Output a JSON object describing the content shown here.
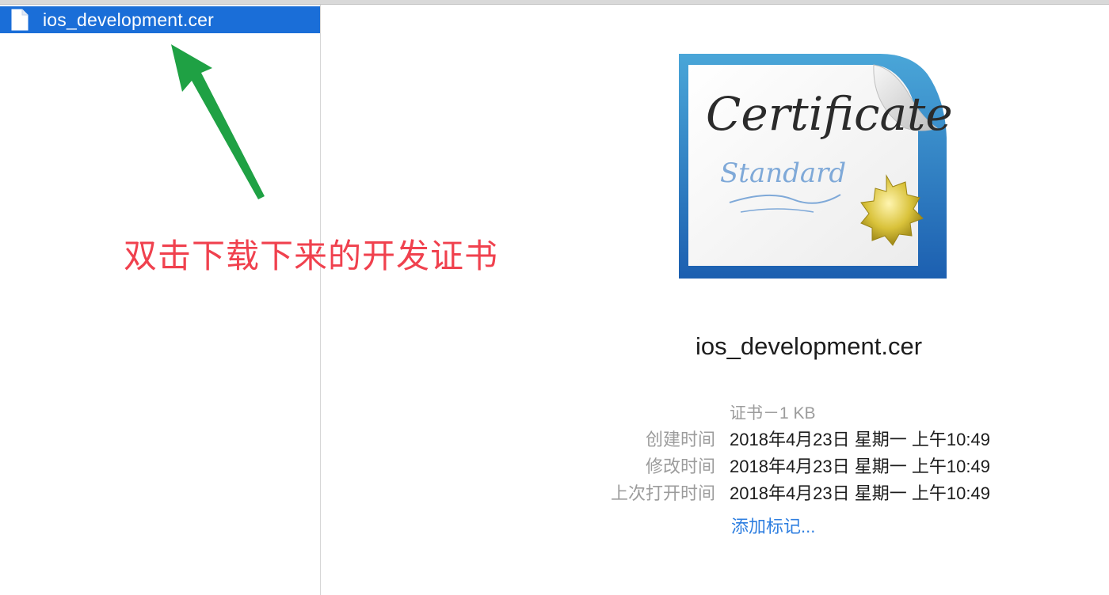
{
  "sidebar": {
    "file_name": "ios_development.cer"
  },
  "annotation": {
    "text": "双击下载下来的开发证书",
    "color": "#f0414e",
    "arrow_color": "#1fa144"
  },
  "preview": {
    "icon": "certificate-icon",
    "icon_text_main": "Certificate",
    "icon_text_sub": "Standard",
    "title": "ios_development.cer",
    "kind": "证书－1 KB",
    "rows": [
      {
        "label": "创建时间",
        "value": "2018年4月23日 星期一 上午10:49"
      },
      {
        "label": "修改时间",
        "value": "2018年4月23日 星期一 上午10:49"
      },
      {
        "label": "上次打开时间",
        "value": "2018年4月23日 星期一 上午10:49"
      }
    ],
    "add_tags": "添加标记..."
  },
  "colors": {
    "selection": "#1a6ed8",
    "link": "#2f7fe0",
    "label": "#9c9c9c"
  }
}
